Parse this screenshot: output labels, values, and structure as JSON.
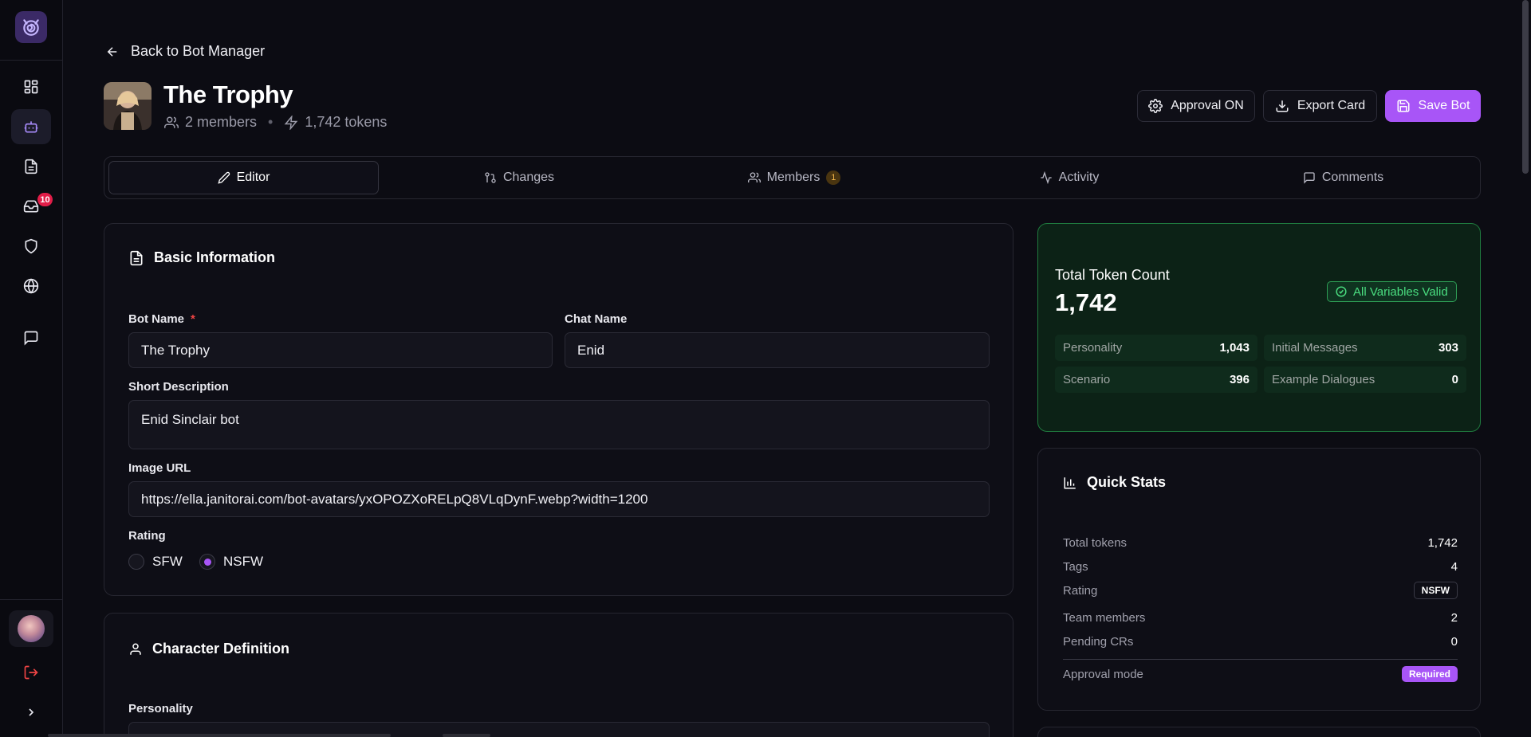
{
  "header": {
    "back_label": "Back to Bot Manager",
    "bot_title": "The Trophy",
    "members_text": "2 members",
    "tokens_text": "1,742 tokens",
    "separator": "•"
  },
  "actions": {
    "approval_label": "Approval ON",
    "export_label": "Export Card",
    "save_label": "Save Bot"
  },
  "sidebar": {
    "notifications_badge": "10"
  },
  "tabs": [
    {
      "label": "Editor"
    },
    {
      "label": "Changes"
    },
    {
      "label": "Members",
      "badge": "1"
    },
    {
      "label": "Activity"
    },
    {
      "label": "Comments"
    }
  ],
  "basic_info": {
    "title": "Basic Information",
    "bot_name_label": "Bot Name",
    "required_mark": "*",
    "bot_name_value": "The Trophy",
    "chat_name_label": "Chat Name",
    "chat_name_value": "Enid",
    "short_desc_label": "Short Description",
    "short_desc_value": "Enid Sinclair bot",
    "image_url_label": "Image URL",
    "image_url_value": "https://ella.janitorai.com/bot-avatars/yxOPOZXoRELpQ8VLqDynF.webp?width=1200",
    "rating_label": "Rating",
    "rating_options": [
      "SFW",
      "NSFW"
    ],
    "rating_selected": "NSFW"
  },
  "character_def": {
    "title": "Character Definition",
    "personality_label": "Personality"
  },
  "token_card": {
    "title": "Total Token Count",
    "total": "1,742",
    "valid_label": "All Variables Valid",
    "cells": [
      {
        "key": "Personality",
        "value": "1,043"
      },
      {
        "key": "Initial Messages",
        "value": "303"
      },
      {
        "key": "Scenario",
        "value": "396"
      },
      {
        "key": "Example Dialogues",
        "value": "0"
      }
    ]
  },
  "quick_stats": {
    "title": "Quick Stats",
    "rows": [
      {
        "key": "Total tokens",
        "value": "1,742"
      },
      {
        "key": "Tags",
        "value": "4"
      },
      {
        "key": "Rating",
        "value": "NSFW"
      },
      {
        "key": "Team members",
        "value": "2"
      },
      {
        "key": "Pending CRs",
        "value": "0"
      },
      {
        "key": "Approval mode",
        "value": "Required"
      }
    ]
  },
  "colors": {
    "accent": "#a855f7",
    "valid_green": "#4ade80",
    "badge_red": "#e11d48"
  }
}
